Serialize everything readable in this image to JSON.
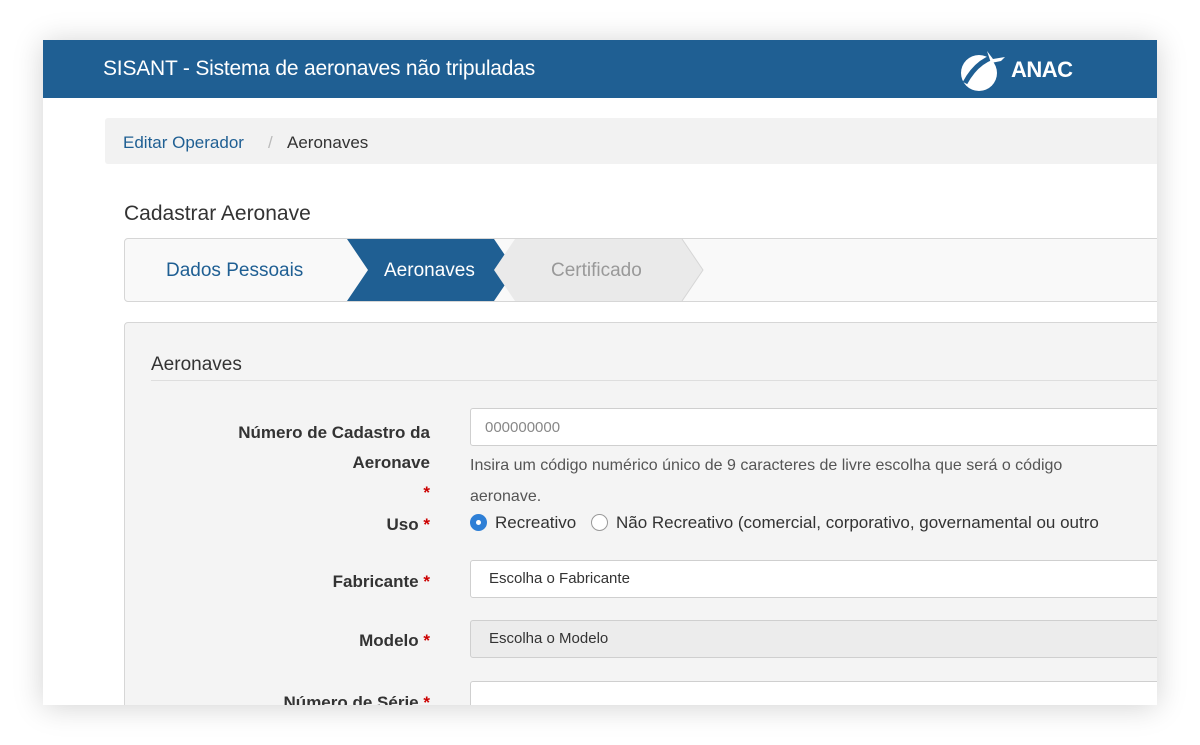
{
  "header": {
    "app_title": "SISANT - Sistema de aeronaves não tripuladas",
    "logo_text": "ANAC",
    "brand_color": "#1f5f93"
  },
  "breadcrumb": {
    "link": "Editar Operador",
    "separator": "/",
    "current": "Aeronaves"
  },
  "page_title": "Cadastrar Aeronave",
  "wizard": {
    "steps": [
      {
        "label": "Dados Pessoais",
        "state": "completed"
      },
      {
        "label": "Aeronaves",
        "state": "active"
      },
      {
        "label": "Certificado",
        "state": "pending"
      }
    ]
  },
  "panel": {
    "title": "Aeronaves",
    "required_mark": "*",
    "fields": {
      "numero_cadastro": {
        "label_line1": "Número de Cadastro da",
        "label_line2": "Aeronave",
        "placeholder": "000000000",
        "help_line1": "Insira um código numérico único de 9 caracteres de livre escolha que será o código",
        "help_line2": "aeronave."
      },
      "uso": {
        "label": "Uso",
        "options": [
          {
            "label": "Recreativo",
            "selected": true
          },
          {
            "label": "Não Recreativo (comercial, corporativo, governamental ou outro",
            "selected": false
          }
        ]
      },
      "fabricante": {
        "label": "Fabricante",
        "value": "Escolha o Fabricante"
      },
      "modelo": {
        "label": "Modelo",
        "value": "Escolha o Modelo",
        "disabled": true
      },
      "numero_serie": {
        "label": "Número de Série",
        "value": ""
      }
    }
  }
}
